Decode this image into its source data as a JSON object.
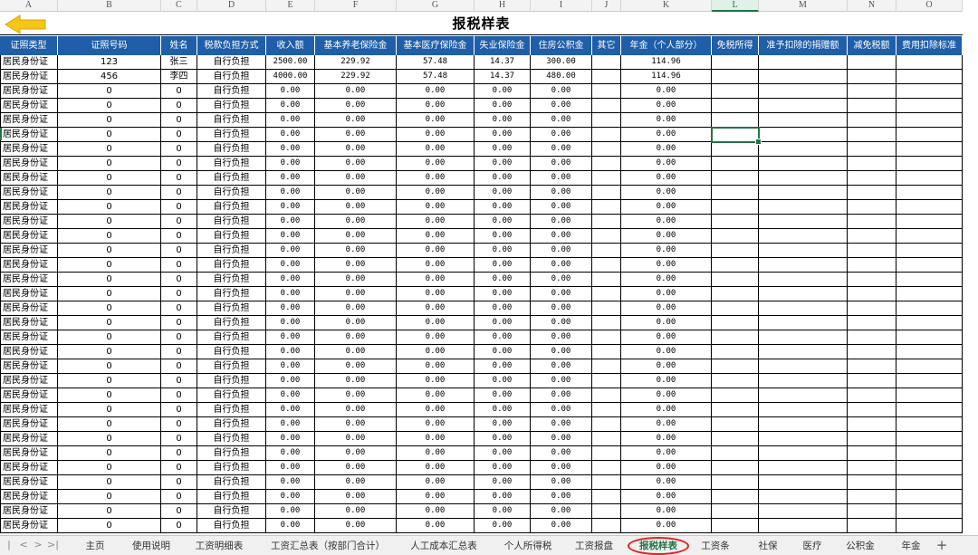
{
  "sheet": {
    "title": "报税样表",
    "column_letters": [
      "A",
      "B",
      "C",
      "D",
      "E",
      "F",
      "G",
      "H",
      "I",
      "J",
      "K",
      "L",
      "M",
      "N",
      "O"
    ],
    "selected_column": "L",
    "selected_cell": "L6",
    "headers": [
      "证照类型",
      "证照号码",
      "姓名",
      "税款负担方式",
      "收入额",
      "基本养老保险金",
      "基本医疗保险金",
      "失业保险金",
      "住房公积金",
      "其它",
      "年金（个人部分）",
      "免税所得",
      "准予扣除的捐赠额",
      "减免税额",
      "费用扣除标准"
    ],
    "rows": [
      [
        "居民身份证",
        "123",
        "张三",
        "自行负担",
        "2500.00",
        "229.92",
        "57.48",
        "14.37",
        "300.00",
        "",
        "114.96",
        "",
        "",
        "",
        ""
      ],
      [
        "居民身份证",
        "456",
        "李四",
        "自行负担",
        "4000.00",
        "229.92",
        "57.48",
        "14.37",
        "480.00",
        "",
        "114.96",
        "",
        "",
        "",
        ""
      ],
      [
        "居民身份证",
        "0",
        "0",
        "自行负担",
        "0.00",
        "0.00",
        "0.00",
        "0.00",
        "0.00",
        "",
        "0.00",
        "",
        "",
        "",
        ""
      ],
      [
        "居民身份证",
        "0",
        "0",
        "自行负担",
        "0.00",
        "0.00",
        "0.00",
        "0.00",
        "0.00",
        "",
        "0.00",
        "",
        "",
        "",
        ""
      ],
      [
        "居民身份证",
        "0",
        "0",
        "自行负担",
        "0.00",
        "0.00",
        "0.00",
        "0.00",
        "0.00",
        "",
        "0.00",
        "",
        "",
        "",
        ""
      ],
      [
        "居民身份证",
        "0",
        "0",
        "自行负担",
        "0.00",
        "0.00",
        "0.00",
        "0.00",
        "0.00",
        "",
        "0.00",
        "",
        "",
        "",
        ""
      ],
      [
        "居民身份证",
        "0",
        "0",
        "自行负担",
        "0.00",
        "0.00",
        "0.00",
        "0.00",
        "0.00",
        "",
        "0.00",
        "",
        "",
        "",
        ""
      ],
      [
        "居民身份证",
        "0",
        "0",
        "自行负担",
        "0.00",
        "0.00",
        "0.00",
        "0.00",
        "0.00",
        "",
        "0.00",
        "",
        "",
        "",
        ""
      ],
      [
        "居民身份证",
        "0",
        "0",
        "自行负担",
        "0.00",
        "0.00",
        "0.00",
        "0.00",
        "0.00",
        "",
        "0.00",
        "",
        "",
        "",
        ""
      ],
      [
        "居民身份证",
        "0",
        "0",
        "自行负担",
        "0.00",
        "0.00",
        "0.00",
        "0.00",
        "0.00",
        "",
        "0.00",
        "",
        "",
        "",
        ""
      ],
      [
        "居民身份证",
        "0",
        "0",
        "自行负担",
        "0.00",
        "0.00",
        "0.00",
        "0.00",
        "0.00",
        "",
        "0.00",
        "",
        "",
        "",
        ""
      ],
      [
        "居民身份证",
        "0",
        "0",
        "自行负担",
        "0.00",
        "0.00",
        "0.00",
        "0.00",
        "0.00",
        "",
        "0.00",
        "",
        "",
        "",
        ""
      ],
      [
        "居民身份证",
        "0",
        "0",
        "自行负担",
        "0.00",
        "0.00",
        "0.00",
        "0.00",
        "0.00",
        "",
        "0.00",
        "",
        "",
        "",
        ""
      ],
      [
        "居民身份证",
        "0",
        "0",
        "自行负担",
        "0.00",
        "0.00",
        "0.00",
        "0.00",
        "0.00",
        "",
        "0.00",
        "",
        "",
        "",
        ""
      ],
      [
        "居民身份证",
        "0",
        "0",
        "自行负担",
        "0.00",
        "0.00",
        "0.00",
        "0.00",
        "0.00",
        "",
        "0.00",
        "",
        "",
        "",
        ""
      ],
      [
        "居民身份证",
        "0",
        "0",
        "自行负担",
        "0.00",
        "0.00",
        "0.00",
        "0.00",
        "0.00",
        "",
        "0.00",
        "",
        "",
        "",
        ""
      ],
      [
        "居民身份证",
        "0",
        "0",
        "自行负担",
        "0.00",
        "0.00",
        "0.00",
        "0.00",
        "0.00",
        "",
        "0.00",
        "",
        "",
        "",
        ""
      ],
      [
        "居民身份证",
        "0",
        "0",
        "自行负担",
        "0.00",
        "0.00",
        "0.00",
        "0.00",
        "0.00",
        "",
        "0.00",
        "",
        "",
        "",
        ""
      ],
      [
        "居民身份证",
        "0",
        "0",
        "自行负担",
        "0.00",
        "0.00",
        "0.00",
        "0.00",
        "0.00",
        "",
        "0.00",
        "",
        "",
        "",
        ""
      ],
      [
        "居民身份证",
        "0",
        "0",
        "自行负担",
        "0.00",
        "0.00",
        "0.00",
        "0.00",
        "0.00",
        "",
        "0.00",
        "",
        "",
        "",
        ""
      ],
      [
        "居民身份证",
        "0",
        "0",
        "自行负担",
        "0.00",
        "0.00",
        "0.00",
        "0.00",
        "0.00",
        "",
        "0.00",
        "",
        "",
        "",
        ""
      ],
      [
        "居民身份证",
        "0",
        "0",
        "自行负担",
        "0.00",
        "0.00",
        "0.00",
        "0.00",
        "0.00",
        "",
        "0.00",
        "",
        "",
        "",
        ""
      ],
      [
        "居民身份证",
        "0",
        "0",
        "自行负担",
        "0.00",
        "0.00",
        "0.00",
        "0.00",
        "0.00",
        "",
        "0.00",
        "",
        "",
        "",
        ""
      ],
      [
        "居民身份证",
        "0",
        "0",
        "自行负担",
        "0.00",
        "0.00",
        "0.00",
        "0.00",
        "0.00",
        "",
        "0.00",
        "",
        "",
        "",
        ""
      ],
      [
        "居民身份证",
        "0",
        "0",
        "自行负担",
        "0.00",
        "0.00",
        "0.00",
        "0.00",
        "0.00",
        "",
        "0.00",
        "",
        "",
        "",
        ""
      ],
      [
        "居民身份证",
        "0",
        "0",
        "自行负担",
        "0.00",
        "0.00",
        "0.00",
        "0.00",
        "0.00",
        "",
        "0.00",
        "",
        "",
        "",
        ""
      ],
      [
        "居民身份证",
        "0",
        "0",
        "自行负担",
        "0.00",
        "0.00",
        "0.00",
        "0.00",
        "0.00",
        "",
        "0.00",
        "",
        "",
        "",
        ""
      ],
      [
        "居民身份证",
        "0",
        "0",
        "自行负担",
        "0.00",
        "0.00",
        "0.00",
        "0.00",
        "0.00",
        "",
        "0.00",
        "",
        "",
        "",
        ""
      ],
      [
        "居民身份证",
        "0",
        "0",
        "自行负担",
        "0.00",
        "0.00",
        "0.00",
        "0.00",
        "0.00",
        "",
        "0.00",
        "",
        "",
        "",
        ""
      ],
      [
        "居民身份证",
        "0",
        "0",
        "自行负担",
        "0.00",
        "0.00",
        "0.00",
        "0.00",
        "0.00",
        "",
        "0.00",
        "",
        "",
        "",
        ""
      ],
      [
        "居民身份证",
        "0",
        "0",
        "自行负担",
        "0.00",
        "0.00",
        "0.00",
        "0.00",
        "0.00",
        "",
        "0.00",
        "",
        "",
        "",
        ""
      ],
      [
        "居民身份证",
        "0",
        "0",
        "自行负担",
        "0.00",
        "0.00",
        "0.00",
        "0.00",
        "0.00",
        "",
        "0.00",
        "",
        "",
        "",
        ""
      ],
      [
        "居民身份证",
        "0",
        "0",
        "自行负担",
        "0.00",
        "0.00",
        "0.00",
        "0.00",
        "0.00",
        "",
        "0.00",
        "",
        "",
        "",
        ""
      ]
    ]
  },
  "icons": {
    "back": "back-arrow-icon",
    "add_sheet": "plus-icon",
    "nav": [
      "first-sheet-icon",
      "prev-sheet-icon",
      "next-sheet-icon",
      "last-sheet-icon"
    ]
  },
  "tabs": {
    "nav_glyphs": [
      "|<",
      "<",
      ">",
      ">|"
    ],
    "items": [
      "主页",
      "使用说明",
      "工资明细表",
      "工资汇总表（按部门合计）",
      "人工成本汇总表",
      "个人所得税",
      "工资报盘",
      "报税样表",
      "工资条",
      "社保",
      "医疗",
      "公积金",
      "年金"
    ],
    "active": "报税样表",
    "add_glyph": "+"
  },
  "colors": {
    "header_bg": "#1f5ea8",
    "back_arrow": "#f5c518",
    "selection": "#217346",
    "tab_highlight_ring": "#e02020"
  }
}
